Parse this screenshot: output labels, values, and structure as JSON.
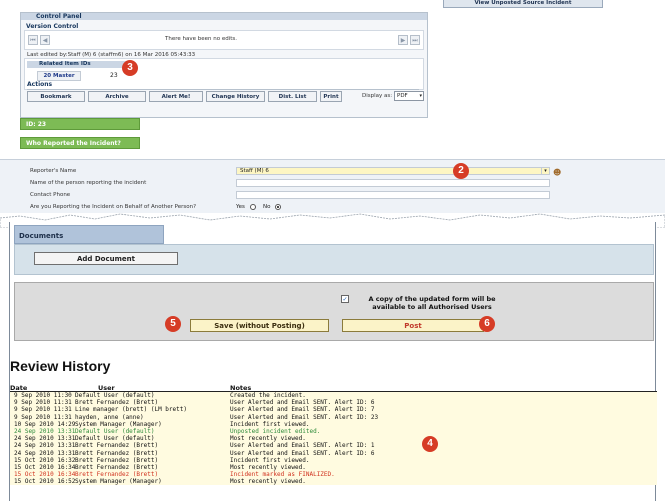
{
  "top_button": "View Unposted Source Incident",
  "control_panel": {
    "title": "Control Panel",
    "version_control_label": "Version Control",
    "no_edits_text": "There have been no edits.",
    "last_edited": "Last edited by:Staff (M) 6 (staffm6) on 16 Mar 2016 05:43:33",
    "related_label": "Related Item IDs",
    "related_master": "20 Master",
    "related_id": "23",
    "actions_label": "Actions",
    "actions": [
      "Bookmark",
      "Archive",
      "Alert Me!",
      "Change History",
      "Dist. List",
      "Print"
    ],
    "display_as_label": "Display as:",
    "display_as_value": "PDF"
  },
  "badges": [
    "3",
    "2",
    "4",
    "5",
    "6"
  ],
  "id_label": "ID: 23",
  "section_title": "Who Reported the Incident?",
  "reporter": {
    "name_label": "Reporter's Name",
    "name_value": "Staff (M) 6",
    "person_label": "Name of the person reporting the incident",
    "phone_label": "Contact Phone",
    "behalf_label": "Are you Reporting the Incident on Behalf of Another Person?",
    "yes_label": "Yes",
    "no_label": "No",
    "behalf_value": "No"
  },
  "documents": {
    "tab_label": "Documents",
    "add_button": "Add Document"
  },
  "posting": {
    "copy_text": "A copy of the updated form will be available to all Authorised Users",
    "copy_checked": true,
    "save_button": "Save (without Posting)",
    "post_button": "Post"
  },
  "review_history": {
    "title": "Review History",
    "columns": [
      "Date",
      "User",
      "Notes"
    ],
    "rows": [
      {
        "date": " 9 Sep 2010 11:30",
        "user": "Default User (default)",
        "notes": "Created the incident.",
        "color": "#111111"
      },
      {
        "date": " 9 Sep 2010 11:31",
        "user": "Brett Fernandez (Brett)",
        "notes": "User Alerted and Email SENT. Alert ID: 6",
        "color": "#111111"
      },
      {
        "date": " 9 Sep 2010 11:31",
        "user": "Line manager (brett) (LM brett)",
        "notes": "User Alerted and Email SENT. Alert ID: 7",
        "color": "#111111"
      },
      {
        "date": " 9 Sep 2010 11:31",
        "user": "hayden, anne (anne)",
        "notes": "User Alerted and Email SENT. Alert ID: 23",
        "color": "#111111"
      },
      {
        "date": "10 Sep 2010 14:29",
        "user": "System Manager (Manager)",
        "notes": "Incident first viewed.",
        "color": "#111111"
      },
      {
        "date": "24 Sep 2010 13:31",
        "user": "Default User (default)",
        "notes": "Unposted incident edited.",
        "color": "#2e8b3a"
      },
      {
        "date": "24 Sep 2010 13:31",
        "user": "Default User (default)",
        "notes": "Most recently viewed.",
        "color": "#111111"
      },
      {
        "date": "24 Sep 2010 13:31",
        "user": "Brett Fernandez (Brett)",
        "notes": "User Alerted and Email SENT. Alert ID: 1",
        "color": "#111111"
      },
      {
        "date": "24 Sep 2010 13:31",
        "user": "Brett Fernandez (Brett)",
        "notes": "User Alerted and Email SENT. Alert ID: 6",
        "color": "#111111"
      },
      {
        "date": "15 Oct 2010 16:32",
        "user": "Brett Fernandez (Brett)",
        "notes": "Incident first viewed.",
        "color": "#111111"
      },
      {
        "date": "15 Oct 2010 16:34",
        "user": "Brett Fernandez (Brett)",
        "notes": "Most recently viewed.",
        "color": "#111111"
      },
      {
        "date": "15 Oct 2010 16:34",
        "user": "Brett Fernandez (Brett)",
        "notes": "Incident marked as FINALIZED.",
        "color": "#d0321e"
      },
      {
        "date": "15 Oct 2010 16:52",
        "user": "System Manager (Manager)",
        "notes": "Most recently viewed.",
        "color": "#111111"
      }
    ]
  },
  "colors": {
    "accent_blue": "#17365d",
    "green_label": "#7dbb55",
    "badge_red": "#d63c26",
    "button_yellow": "#fbf3c8"
  }
}
